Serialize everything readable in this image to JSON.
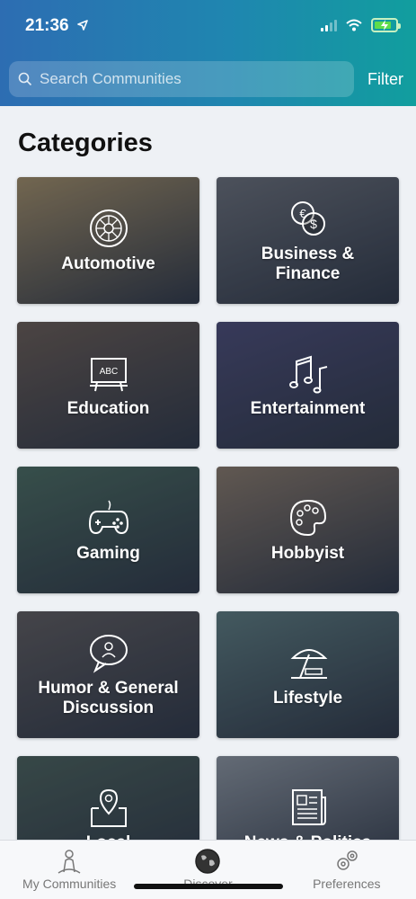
{
  "status_bar": {
    "time": "21:36"
  },
  "search": {
    "placeholder": "Search Communities",
    "filter_label": "Filter"
  },
  "page_title": "Categories",
  "categories": [
    {
      "label": "Automotive",
      "icon": "steering-wheel-icon",
      "bg": "#a58e63"
    },
    {
      "label": "Business &\nFinance",
      "icon": "coins-icon",
      "bg": "#6b6e74"
    },
    {
      "label": "Education",
      "icon": "chalkboard-icon",
      "bg": "#6a5a4e"
    },
    {
      "label": "Entertainment",
      "icon": "music-notes-icon",
      "bg": "#4b4a72"
    },
    {
      "label": "Gaming",
      "icon": "gamepad-icon",
      "bg": "#4a6a5a"
    },
    {
      "label": "Hobbyist",
      "icon": "palette-icon",
      "bg": "#8a7865"
    },
    {
      "label": "Humor & General\nDiscussion",
      "icon": "chat-bubble-icon",
      "bg": "#5f5a58"
    },
    {
      "label": "Lifestyle",
      "icon": "beach-umbrella-icon",
      "bg": "#5d7a7a"
    },
    {
      "label": "Local",
      "icon": "map-pin-icon",
      "bg": "#4a5f55"
    },
    {
      "label": "News & Politics",
      "icon": "newspaper-icon",
      "bg": "#8e959c"
    }
  ],
  "tabs": [
    {
      "label": "My Communities",
      "icon": "person-community-icon"
    },
    {
      "label": "Discover",
      "icon": "globe-icon"
    },
    {
      "label": "Preferences",
      "icon": "gears-icon"
    }
  ],
  "colors": {
    "header_start": "#2d6db2",
    "header_end": "#119e9e",
    "background": "#eef1f5"
  }
}
